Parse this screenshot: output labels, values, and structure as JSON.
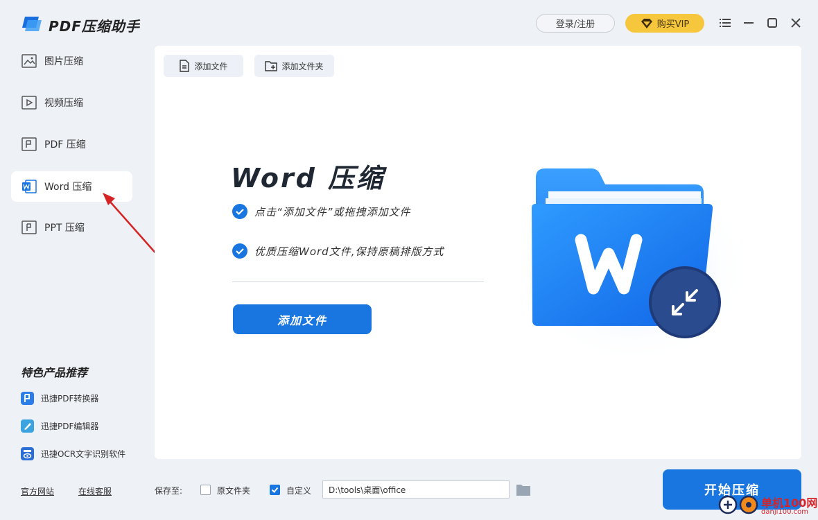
{
  "app": {
    "title": "PDF压缩助手",
    "login_label": "登录/注册",
    "vip_label": "购买VIP",
    "accent": "#1976e0",
    "vip_color": "#f6c63c"
  },
  "window_controls": [
    "menu-icon",
    "minimize-icon",
    "maximize-icon",
    "close-icon"
  ],
  "sidebar": {
    "items": [
      {
        "label": "图片压缩",
        "icon": "image-compress-icon",
        "active": false
      },
      {
        "label": "视频压缩",
        "icon": "video-compress-icon",
        "active": false
      },
      {
        "label": "PDF 压缩",
        "icon": "pdf-compress-icon",
        "active": false
      },
      {
        "label": "Word 压缩",
        "icon": "word-compress-icon",
        "active": true
      },
      {
        "label": "PPT 压缩",
        "icon": "ppt-compress-icon",
        "active": false
      }
    ],
    "featured_title": "特色产品推荐",
    "products": [
      {
        "label": "迅捷PDF转换器",
        "icon": "pdf-converter-icon"
      },
      {
        "label": "迅捷PDF编辑器",
        "icon": "pdf-editor-icon"
      },
      {
        "label": "迅捷OCR文字识别软件",
        "icon": "ocr-icon"
      }
    ],
    "footer": {
      "official_site": "官方网站",
      "online_support": "在线客服"
    }
  },
  "toolbar": {
    "add_file": "添加文件",
    "add_folder": "添加文件夹"
  },
  "hero": {
    "title": "Word 压缩",
    "bullet_1": "点击“添加文件”或拖拽添加文件",
    "bullet_2": "优质压缩Word文件,保持原稿排版方式",
    "add_button": "添加文件"
  },
  "bottom": {
    "save_to_label": "保存至:",
    "original_folder_label": "原文件夹",
    "original_folder_checked": false,
    "custom_label": "自定义",
    "custom_checked": true,
    "path_value": "D:\\tools\\桌面\\office",
    "start_button": "开始压缩"
  },
  "watermark": {
    "brand": "单机100网",
    "url": "danji100.com"
  }
}
